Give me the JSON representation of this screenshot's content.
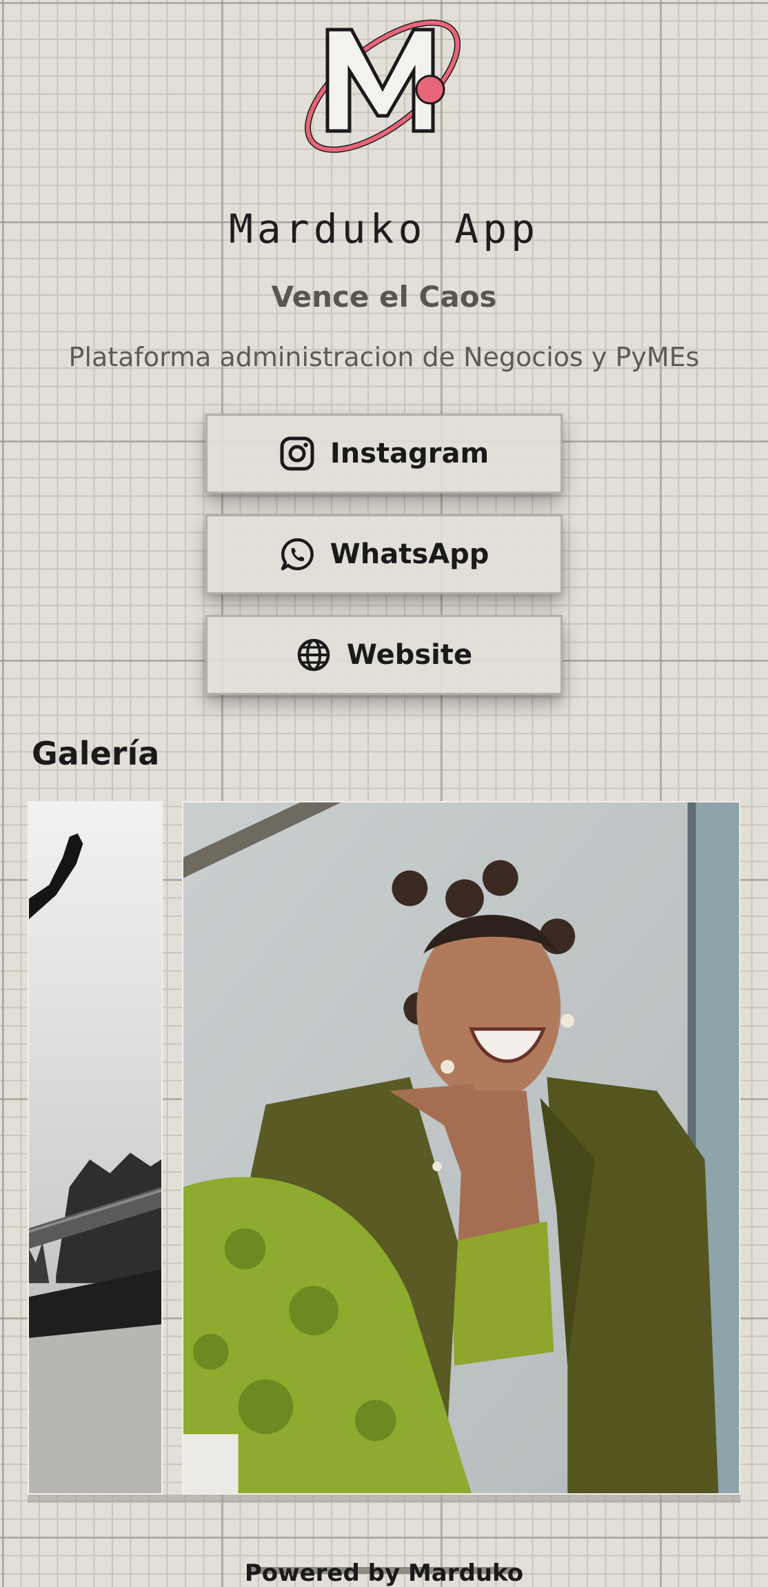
{
  "profile": {
    "title": "Marduko App",
    "tagline": "Vence el Caos",
    "description": "Plataforma administracion de Negocios y PyMEs",
    "logo_icon": "marduko-logo"
  },
  "links": [
    {
      "label": "Instagram",
      "icon": "instagram-icon"
    },
    {
      "label": "WhatsApp",
      "icon": "whatsapp-icon"
    },
    {
      "label": "Website",
      "icon": "globe-icon"
    }
  ],
  "gallery": {
    "title": "Galería",
    "items": [
      {
        "icon": "skateboarder-photo"
      },
      {
        "icon": "laughing-woman-photo"
      }
    ]
  },
  "footer": {
    "text": "Powered by Marduko"
  },
  "colors": {
    "background": "#e2dfd8",
    "grid_line": "#c9c5bd",
    "logo_accent": "#e8657a",
    "text_dark": "#1a1a1a",
    "text_muted": "#5a5550"
  }
}
